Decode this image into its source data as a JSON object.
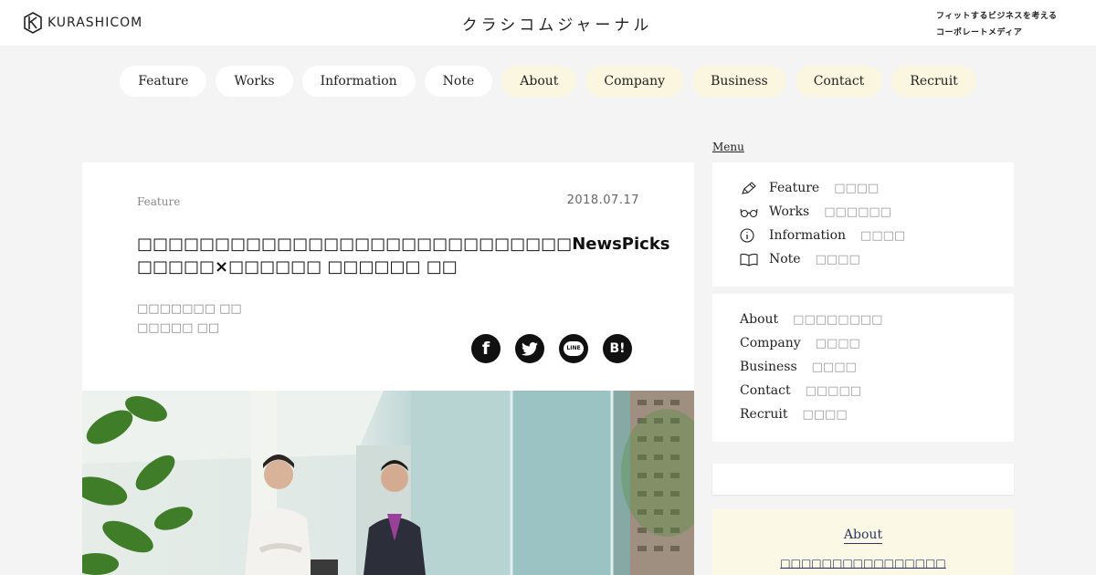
{
  "header": {
    "logo_text": "KURASHICOM",
    "site_title": "クラシコムジャーナル",
    "tagline_line1": "フィットするビジネスを考える",
    "tagline_line2": "コーポレートメディア"
  },
  "nav": {
    "items": [
      {
        "label": "Feature"
      },
      {
        "label": "Works"
      },
      {
        "label": "Information"
      },
      {
        "label": "Note"
      },
      {
        "label": "About"
      },
      {
        "label": "Company"
      },
      {
        "label": "Business"
      },
      {
        "label": "Contact"
      },
      {
        "label": "Recruit"
      }
    ]
  },
  "article": {
    "category": "Feature",
    "date": "2018.07.17",
    "title": "□□□□□□□□□□□□□□□□□□□□□□□□□□□□NewsPicks □□□□□×□□□□□□ □□□□□□ □□",
    "author_line1": "□□□□□□□ □□",
    "author_line2": "□□□□□ □□",
    "share": {
      "facebook": "f",
      "line": "LINE",
      "hatena": "B!"
    }
  },
  "sidebar": {
    "menu_label": "Menu",
    "primary": [
      {
        "label": "Feature",
        "jp": "□□□□",
        "icon": "pen-icon"
      },
      {
        "label": "Works",
        "jp": "□□□□□□",
        "icon": "glasses-icon"
      },
      {
        "label": "Information",
        "jp": "□□□□",
        "icon": "info-icon"
      },
      {
        "label": "Note",
        "jp": "□□□□",
        "icon": "book-icon"
      }
    ],
    "secondary": [
      {
        "label": "About",
        "jp": "□□□□□□□□"
      },
      {
        "label": "Company",
        "jp": "□□□□"
      },
      {
        "label": "Business",
        "jp": "□□□□"
      },
      {
        "label": "Contact",
        "jp": "□□□□□"
      },
      {
        "label": "Recruit",
        "jp": "□□□□"
      }
    ],
    "about": {
      "heading": "About",
      "subtitle": "□□□□□□□□□□□□□□□□"
    }
  },
  "colors": {
    "page_bg": "#f4f4f4",
    "cream": "#faf6e0",
    "navy": "#2a3566"
  }
}
